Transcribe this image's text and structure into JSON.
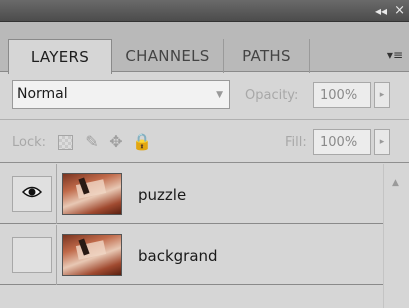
{
  "panel": {
    "titlebar": {
      "collapse_glyph": "◂◂",
      "close_glyph": "×"
    },
    "tabs": [
      {
        "label": "LAYERS",
        "active": true
      },
      {
        "label": "CHANNELS",
        "active": false
      },
      {
        "label": "PATHS",
        "active": false
      }
    ],
    "menu_glyph": "▾≡",
    "blend_mode": {
      "value": "Normal",
      "arrow": "▼"
    },
    "opacity": {
      "label": "Opacity:",
      "value": "100%",
      "arrow": "▸"
    },
    "lock": {
      "label": "Lock:",
      "icons": {
        "pixels": "✎",
        "position": "✥",
        "all": "🔒"
      }
    },
    "fill": {
      "label": "Fill:",
      "value": "100%",
      "arrow": "▸"
    },
    "layers": [
      {
        "name": "puzzle",
        "visible": true
      },
      {
        "name": "backgrand",
        "visible": false
      }
    ],
    "scroll_up_glyph": "▲"
  }
}
